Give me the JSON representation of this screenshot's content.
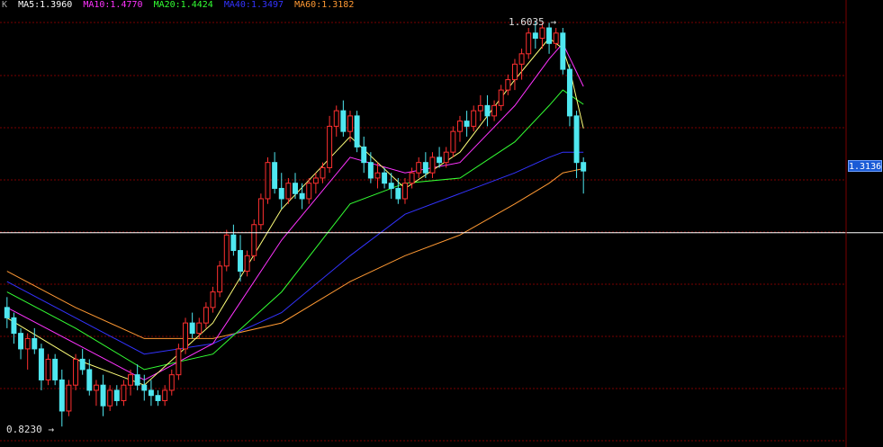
{
  "legend": {
    "prefix": "K",
    "items": [
      {
        "label": "MA5:1.3960",
        "color": "#ffffff"
      },
      {
        "label": "MA10:1.4770",
        "color": "#ff33ff"
      },
      {
        "label": "MA20:1.4424",
        "color": "#33ff33"
      },
      {
        "label": "MA40:1.3497",
        "color": "#3333ff"
      },
      {
        "label": "MA60:1.3182",
        "color": "#ff9933"
      }
    ]
  },
  "last_price": "1.3136",
  "high_label": "1.6035",
  "low_label": "0.8230",
  "colors": {
    "up": "#ff3030",
    "down": "#4fe7f0",
    "grid": "#7a0000",
    "crosshair": "#ffffff",
    "ma5": "#ffff7a",
    "ma10": "#ff33ff",
    "ma20": "#33ff33",
    "ma40": "#3333ff",
    "ma60": "#ff9933"
  },
  "chart_data": {
    "type": "candlestick",
    "y_range": [
      0.81,
      1.63
    ],
    "grid": true,
    "crosshair_price": 1.1944,
    "candles": [
      [
        1.05,
        1.07,
        1.01,
        1.03
      ],
      [
        1.03,
        1.04,
        0.98,
        1.0
      ],
      [
        1.0,
        1.01,
        0.95,
        0.97
      ],
      [
        0.97,
        1.0,
        0.93,
        0.99
      ],
      [
        0.99,
        1.01,
        0.96,
        0.97
      ],
      [
        0.97,
        0.98,
        0.89,
        0.91
      ],
      [
        0.91,
        0.96,
        0.9,
        0.95
      ],
      [
        0.95,
        0.96,
        0.9,
        0.91
      ],
      [
        0.91,
        0.93,
        0.82,
        0.85
      ],
      [
        0.85,
        0.91,
        0.84,
        0.9
      ],
      [
        0.9,
        0.96,
        0.89,
        0.95
      ],
      [
        0.95,
        0.97,
        0.92,
        0.93
      ],
      [
        0.93,
        0.95,
        0.88,
        0.89
      ],
      [
        0.89,
        0.91,
        0.86,
        0.9
      ],
      [
        0.9,
        0.92,
        0.84,
        0.86
      ],
      [
        0.86,
        0.9,
        0.85,
        0.89
      ],
      [
        0.89,
        0.9,
        0.86,
        0.87
      ],
      [
        0.87,
        0.91,
        0.86,
        0.9
      ],
      [
        0.9,
        0.93,
        0.88,
        0.92
      ],
      [
        0.92,
        0.94,
        0.89,
        0.9
      ],
      [
        0.9,
        0.92,
        0.87,
        0.89
      ],
      [
        0.89,
        0.91,
        0.86,
        0.88
      ],
      [
        0.88,
        0.89,
        0.86,
        0.87
      ],
      [
        0.87,
        0.9,
        0.86,
        0.89
      ],
      [
        0.89,
        0.93,
        0.88,
        0.92
      ],
      [
        0.92,
        0.98,
        0.91,
        0.97
      ],
      [
        0.97,
        1.03,
        0.96,
        1.02
      ],
      [
        1.02,
        1.04,
        0.99,
        1.0
      ],
      [
        1.0,
        1.03,
        0.99,
        1.02
      ],
      [
        1.02,
        1.06,
        1.01,
        1.05
      ],
      [
        1.05,
        1.09,
        1.04,
        1.08
      ],
      [
        1.08,
        1.14,
        1.07,
        1.13
      ],
      [
        1.13,
        1.2,
        1.12,
        1.19
      ],
      [
        1.19,
        1.21,
        1.15,
        1.16
      ],
      [
        1.16,
        1.19,
        1.1,
        1.12
      ],
      [
        1.12,
        1.16,
        1.11,
        1.15
      ],
      [
        1.15,
        1.22,
        1.14,
        1.21
      ],
      [
        1.21,
        1.27,
        1.2,
        1.26
      ],
      [
        1.26,
        1.34,
        1.25,
        1.33
      ],
      [
        1.33,
        1.35,
        1.27,
        1.28
      ],
      [
        1.28,
        1.31,
        1.24,
        1.26
      ],
      [
        1.26,
        1.3,
        1.25,
        1.29
      ],
      [
        1.29,
        1.31,
        1.26,
        1.27
      ],
      [
        1.27,
        1.29,
        1.24,
        1.26
      ],
      [
        1.26,
        1.3,
        1.25,
        1.29
      ],
      [
        1.29,
        1.31,
        1.27,
        1.3
      ],
      [
        1.3,
        1.33,
        1.29,
        1.32
      ],
      [
        1.32,
        1.42,
        1.31,
        1.4
      ],
      [
        1.4,
        1.44,
        1.38,
        1.43
      ],
      [
        1.43,
        1.45,
        1.38,
        1.39
      ],
      [
        1.39,
        1.43,
        1.37,
        1.42
      ],
      [
        1.42,
        1.43,
        1.35,
        1.36
      ],
      [
        1.36,
        1.38,
        1.31,
        1.33
      ],
      [
        1.33,
        1.35,
        1.29,
        1.3
      ],
      [
        1.3,
        1.33,
        1.28,
        1.31
      ],
      [
        1.31,
        1.32,
        1.28,
        1.29
      ],
      [
        1.29,
        1.31,
        1.26,
        1.28
      ],
      [
        1.28,
        1.3,
        1.25,
        1.26
      ],
      [
        1.26,
        1.3,
        1.25,
        1.29
      ],
      [
        1.29,
        1.32,
        1.28,
        1.31
      ],
      [
        1.31,
        1.34,
        1.3,
        1.33
      ],
      [
        1.33,
        1.35,
        1.3,
        1.31
      ],
      [
        1.31,
        1.35,
        1.3,
        1.34
      ],
      [
        1.34,
        1.36,
        1.32,
        1.33
      ],
      [
        1.33,
        1.36,
        1.32,
        1.35
      ],
      [
        1.35,
        1.4,
        1.34,
        1.39
      ],
      [
        1.39,
        1.42,
        1.37,
        1.41
      ],
      [
        1.41,
        1.43,
        1.38,
        1.4
      ],
      [
        1.4,
        1.44,
        1.39,
        1.43
      ],
      [
        1.43,
        1.46,
        1.41,
        1.44
      ],
      [
        1.44,
        1.46,
        1.4,
        1.42
      ],
      [
        1.42,
        1.45,
        1.41,
        1.44
      ],
      [
        1.44,
        1.48,
        1.43,
        1.47
      ],
      [
        1.47,
        1.5,
        1.46,
        1.49
      ],
      [
        1.49,
        1.53,
        1.47,
        1.52
      ],
      [
        1.52,
        1.55,
        1.49,
        1.54
      ],
      [
        1.54,
        1.59,
        1.53,
        1.58
      ],
      [
        1.58,
        1.6035,
        1.55,
        1.57
      ],
      [
        1.57,
        1.6,
        1.55,
        1.59
      ],
      [
        1.59,
        1.6,
        1.54,
        1.56
      ],
      [
        1.56,
        1.59,
        1.55,
        1.58
      ],
      [
        1.58,
        1.59,
        1.5,
        1.51
      ],
      [
        1.51,
        1.52,
        1.4,
        1.42
      ],
      [
        1.42,
        1.43,
        1.3,
        1.33
      ],
      [
        1.33,
        1.34,
        1.27,
        1.3136
      ]
    ],
    "ma5": [
      [
        0,
        1.03
      ],
      [
        10,
        0.95
      ],
      [
        20,
        0.9
      ],
      [
        30,
        1.02
      ],
      [
        40,
        1.24
      ],
      [
        50,
        1.38
      ],
      [
        58,
        1.28
      ],
      [
        66,
        1.35
      ],
      [
        74,
        1.49
      ],
      [
        79,
        1.57
      ],
      [
        81,
        1.55
      ],
      [
        82,
        1.51
      ],
      [
        84,
        1.396
      ]
    ],
    "ma10": [
      [
        0,
        1.05
      ],
      [
        10,
        0.98
      ],
      [
        20,
        0.91
      ],
      [
        30,
        0.98
      ],
      [
        40,
        1.18
      ],
      [
        50,
        1.34
      ],
      [
        58,
        1.31
      ],
      [
        66,
        1.33
      ],
      [
        74,
        1.44
      ],
      [
        79,
        1.53
      ],
      [
        81,
        1.56
      ],
      [
        84,
        1.477
      ]
    ],
    "ma20": [
      [
        0,
        1.08
      ],
      [
        10,
        1.01
      ],
      [
        20,
        0.93
      ],
      [
        30,
        0.96
      ],
      [
        40,
        1.08
      ],
      [
        50,
        1.25
      ],
      [
        58,
        1.29
      ],
      [
        66,
        1.3
      ],
      [
        74,
        1.37
      ],
      [
        79,
        1.44
      ],
      [
        81,
        1.47
      ],
      [
        84,
        1.4424
      ]
    ],
    "ma40": [
      [
        0,
        1.1
      ],
      [
        10,
        1.03
      ],
      [
        20,
        0.96
      ],
      [
        30,
        0.98
      ],
      [
        40,
        1.04
      ],
      [
        50,
        1.15
      ],
      [
        58,
        1.23
      ],
      [
        66,
        1.27
      ],
      [
        74,
        1.31
      ],
      [
        79,
        1.34
      ],
      [
        81,
        1.35
      ],
      [
        84,
        1.3497
      ]
    ],
    "ma60": [
      [
        0,
        1.12
      ],
      [
        10,
        1.05
      ],
      [
        20,
        0.99
      ],
      [
        30,
        0.99
      ],
      [
        40,
        1.02
      ],
      [
        50,
        1.1
      ],
      [
        58,
        1.15
      ],
      [
        66,
        1.19
      ],
      [
        74,
        1.25
      ],
      [
        79,
        1.29
      ],
      [
        81,
        1.31
      ],
      [
        84,
        1.3182
      ]
    ]
  }
}
